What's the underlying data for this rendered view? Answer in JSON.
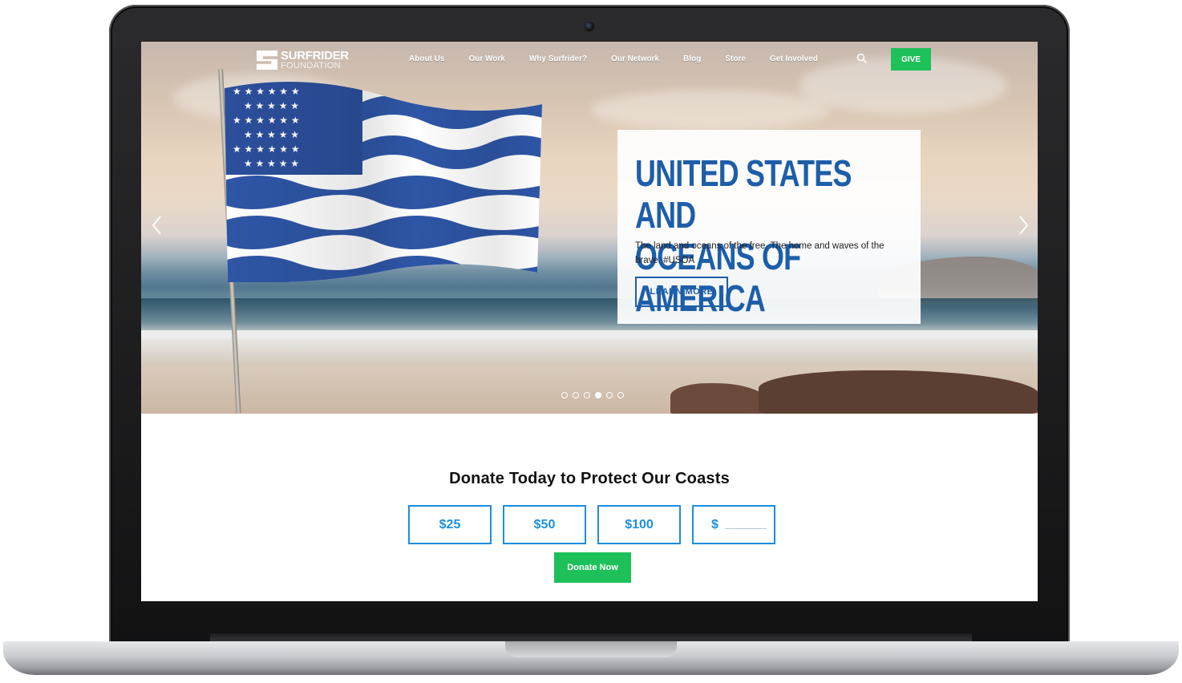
{
  "brand": {
    "line1": "SURFRIDER",
    "line2": "FOUNDATION"
  },
  "nav": {
    "items": [
      "About Us",
      "Our Work",
      "Why Surfrider?",
      "Our Network",
      "Blog",
      "Store",
      "Get Involved"
    ],
    "give_label": "GIVE"
  },
  "hero": {
    "title": "UNITED STATES AND\nOCEANS OF AMERICA",
    "subtitle": "The land and oceans of the free. The home and waves of the brave. #USOA",
    "button_label": "LEARN MORE",
    "slides_total": 6,
    "active_slide": 4
  },
  "donate": {
    "title": "Donate Today to Protect Our Coasts",
    "amounts": [
      "$25",
      "$50",
      "$100"
    ],
    "custom_symbol": "$",
    "button_label": "Donate Now"
  },
  "colors": {
    "brand_blue": "#1d5ea9",
    "amount_blue": "#1d8ee0",
    "green": "#1ec05a"
  },
  "icons": {
    "search": "search-icon",
    "prev": "chevron-left-icon",
    "next": "chevron-right-icon"
  }
}
